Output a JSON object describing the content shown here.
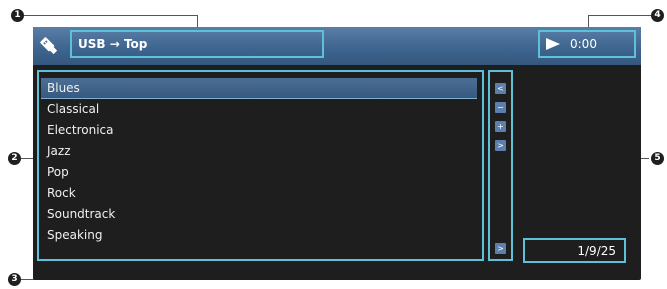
{
  "header": {
    "breadcrumb": "USB → Top",
    "play_time": "0:00"
  },
  "list": {
    "items": [
      "Blues",
      "Classical",
      "Electronica",
      "Jazz",
      "Pop",
      "Rock",
      "Soundtrack",
      "Speaking"
    ],
    "selected_index": 0
  },
  "page_indicator": "1/9/25",
  "scroll": {
    "buttons": [
      "<",
      "−",
      "+",
      ">"
    ],
    "bottom_button": ">"
  },
  "callouts": [
    "1",
    "2",
    "3",
    "4",
    "5"
  ],
  "colors": {
    "header": "#3f6690",
    "frame": "#5fc1d8",
    "background": "#1e1e1e",
    "selected_row": "#4d6f96"
  }
}
